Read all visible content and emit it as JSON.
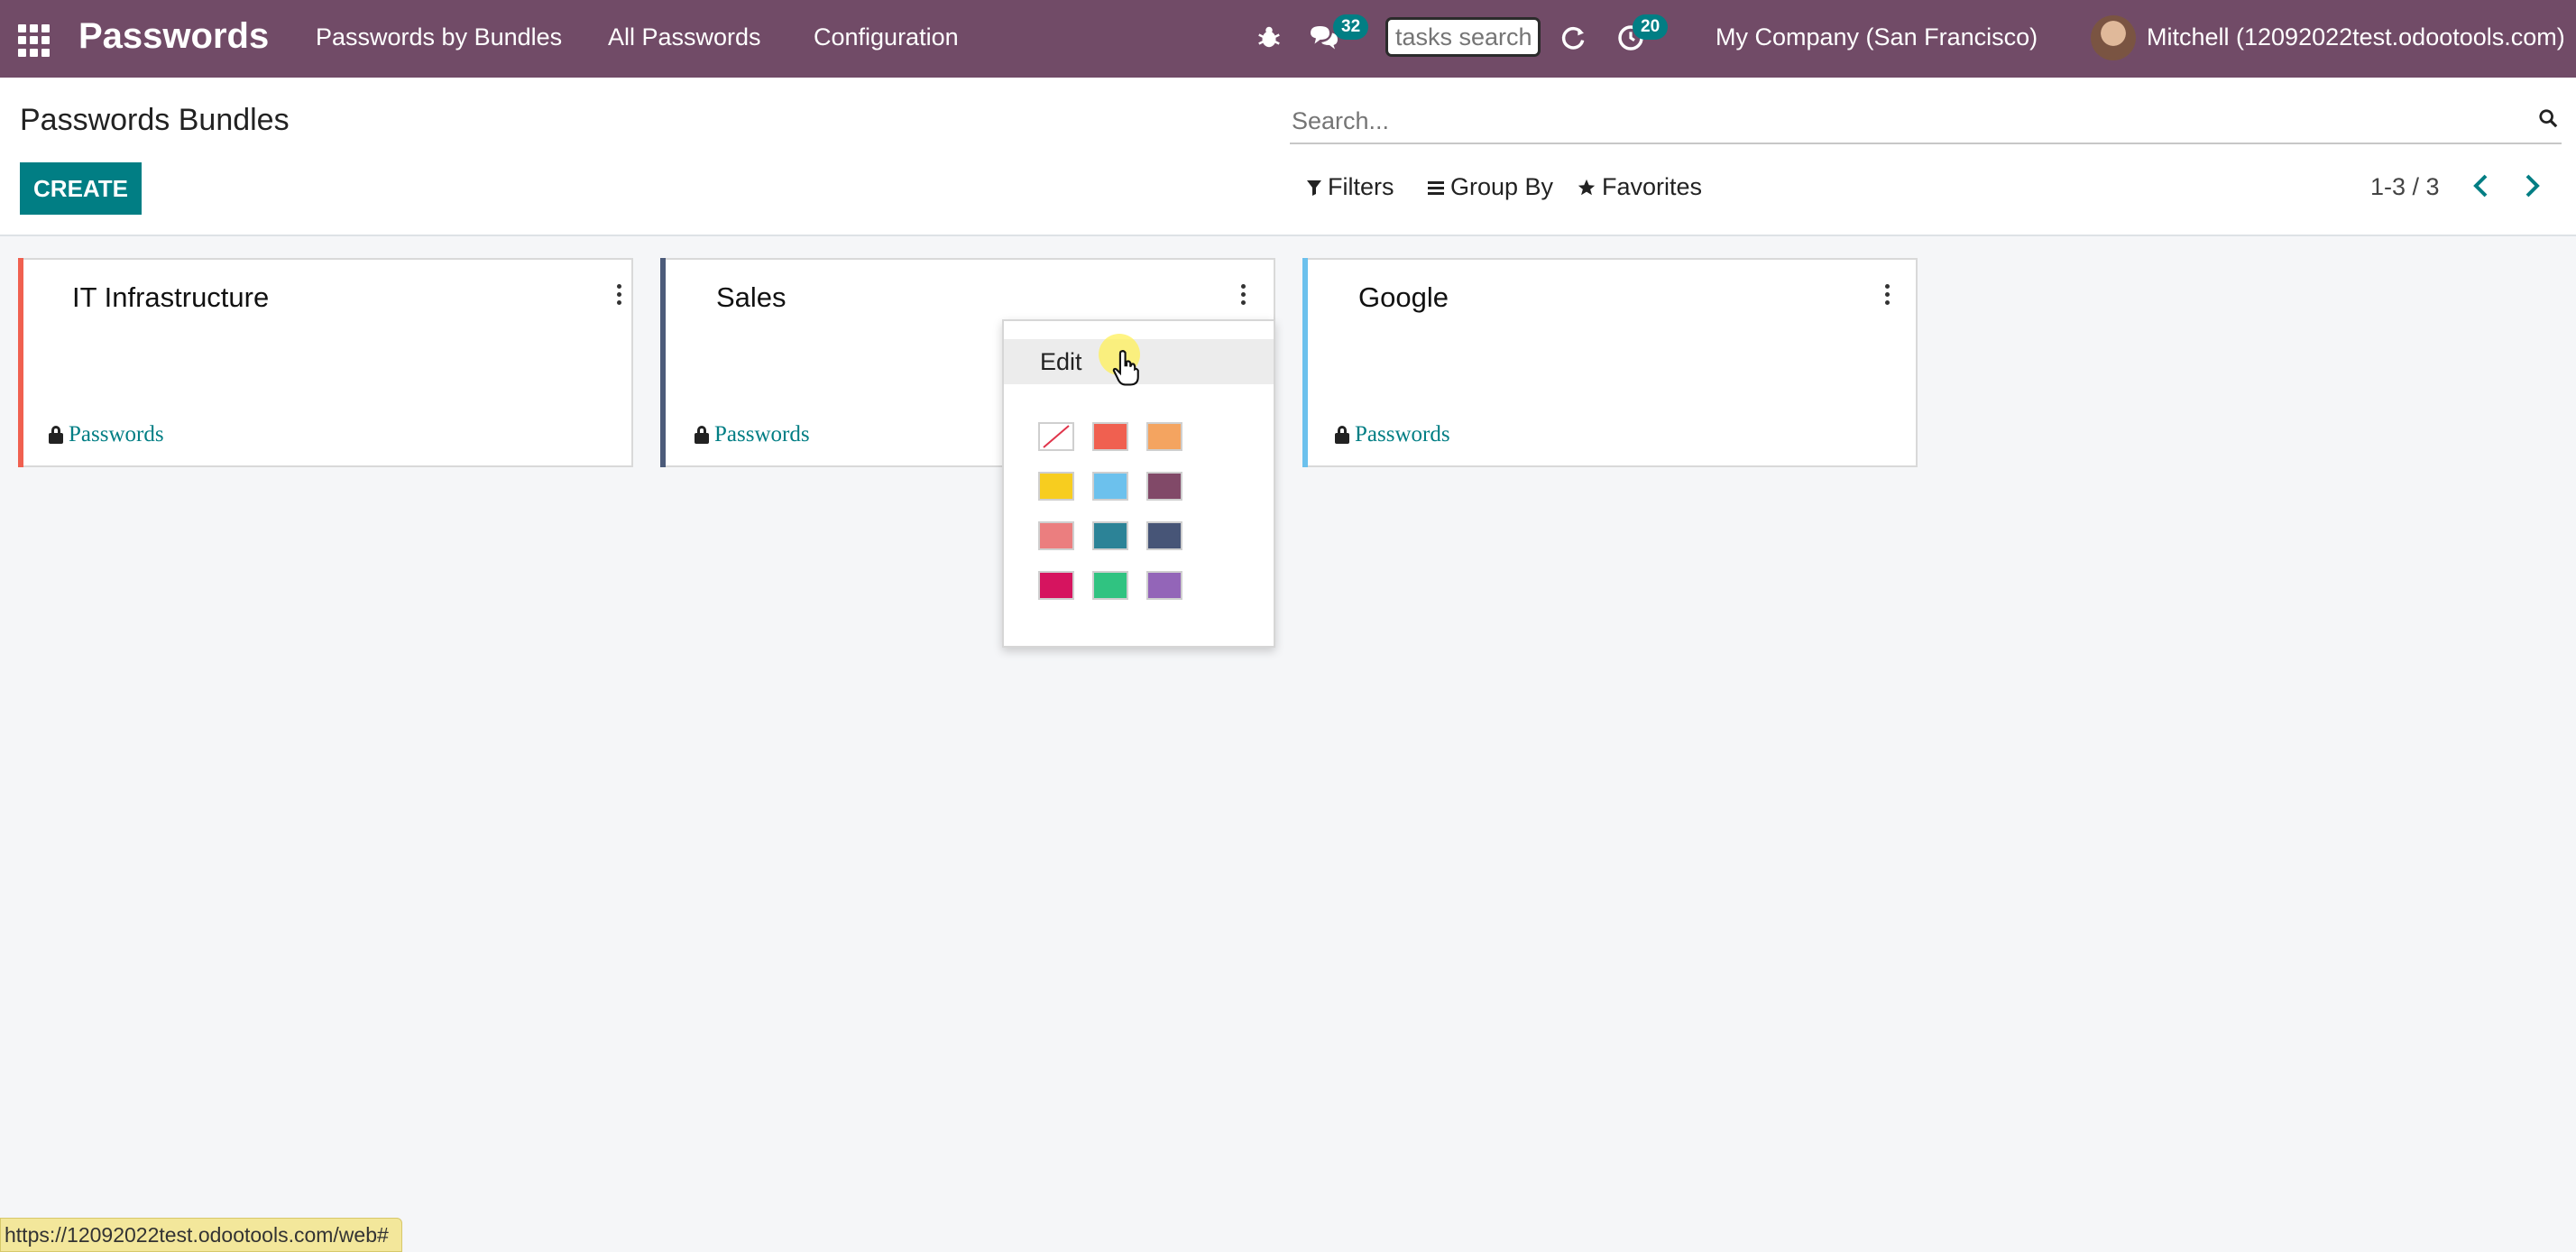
{
  "navbar": {
    "app_title": "Passwords",
    "menu": [
      "Passwords by Bundles",
      "All Passwords",
      "Configuration"
    ],
    "messages_badge": "32",
    "activities_badge": "20",
    "tasks_search_placeholder": "tasks search",
    "company": "My Company (San Francisco)",
    "user": "Mitchell (12092022test.odootools.com)",
    "bg_color": "#714b67"
  },
  "control_panel": {
    "title": "Passwords Bundles",
    "search_placeholder": "Search...",
    "create_label": "CREATE",
    "filters_label": "Filters",
    "group_by_label": "Group By",
    "favorites_label": "Favorites",
    "pager": "1-3 / 3"
  },
  "cards": [
    {
      "title": "IT Infrastructure",
      "tag": "Passwords",
      "color": "#f06050"
    },
    {
      "title": "Sales",
      "tag": "Passwords",
      "color": "#4c5b7a"
    },
    {
      "title": "Google",
      "tag": "Passwords",
      "color": "#6cc1ed"
    }
  ],
  "dropdown": {
    "edit_label": "Edit",
    "colors": [
      "none",
      "#f06050",
      "#f4a460",
      "#f7cd1f",
      "#6cc1ed",
      "#814968",
      "#eb7e7f",
      "#2c8397",
      "#475577",
      "#d6145f",
      "#30c381",
      "#9365b8"
    ]
  },
  "status_url": "https://12092022test.odootools.com/web#",
  "accent_color": "#017e84"
}
